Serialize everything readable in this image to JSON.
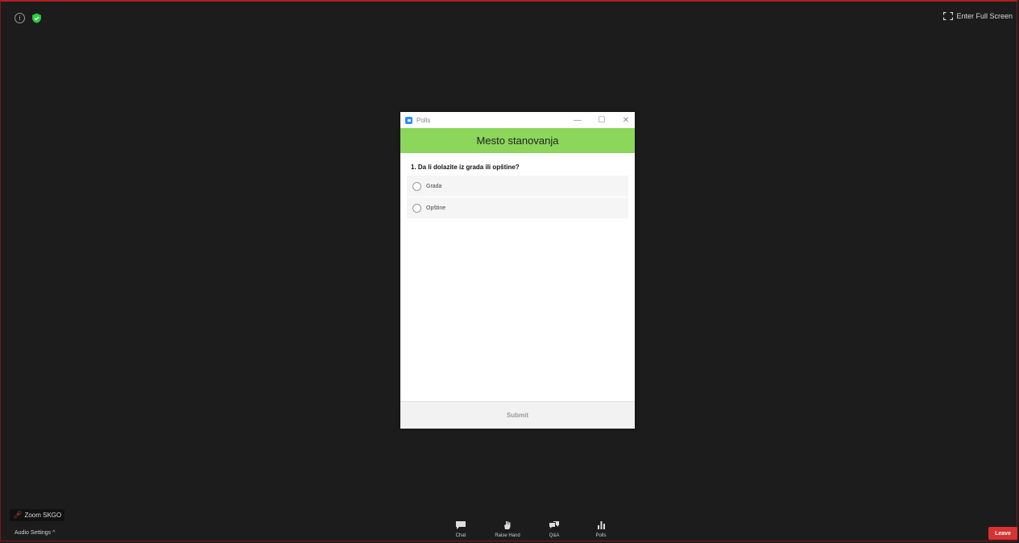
{
  "meeting": {
    "fullscreen_label": "Enter Full Screen",
    "participant_name": "Zoom SKGO",
    "audio_settings_label": "Audio Settings ^",
    "leave_label": "Leave"
  },
  "poll_window": {
    "window_title": "Polls",
    "controls": {
      "minimize": "—",
      "maximize": "☐",
      "close": "✕"
    },
    "poll_title": "Mesto stanovanja",
    "question": "1. Da li dolazite iz grada ili opštine?",
    "options": [
      {
        "label": "Grada",
        "selected": false
      },
      {
        "label": "Opštine",
        "selected": false
      }
    ],
    "submit_label": "Submit"
  },
  "toolbar": {
    "items": [
      {
        "label": "Chat",
        "icon": "chat-icon"
      },
      {
        "label": "Raise Hand",
        "icon": "raise-hand-icon"
      },
      {
        "label": "Q&A",
        "icon": "qa-icon"
      },
      {
        "label": "Polls",
        "icon": "polls-icon"
      }
    ]
  },
  "colors": {
    "background": "#1c1c1c",
    "poll_header": "#8bd65b",
    "leave": "#d83232",
    "shield": "#2ecc40"
  }
}
